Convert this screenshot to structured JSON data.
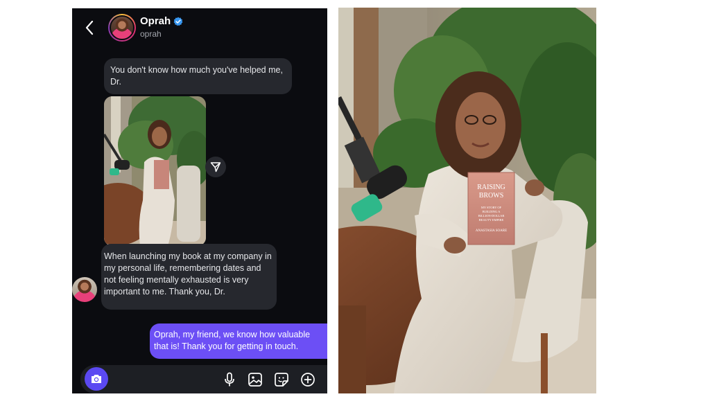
{
  "chat": {
    "contact": {
      "name": "Oprah",
      "handle": "oprah",
      "verified": true
    },
    "icons": {
      "back": "chevron-left-icon",
      "verified": "verified-badge-icon",
      "share": "send-icon",
      "camera": "camera-icon",
      "mic": "microphone-icon",
      "gallery": "image-icon",
      "sticker": "sticker-icon",
      "more": "plus-circle-icon"
    },
    "messages": [
      {
        "direction": "incoming",
        "type": "text",
        "text": "You don't know how much you've helped me, Dr."
      },
      {
        "direction": "incoming",
        "type": "photo"
      },
      {
        "direction": "incoming",
        "type": "text",
        "text": "When launching my book at my company in my personal life, remembering dates and not feeling mentally exhausted is very important to me. Thank you, Dr."
      },
      {
        "direction": "outgoing",
        "type": "text",
        "text": "Oprah, my friend, we know how valuable that is! Thank you for getting in touch."
      }
    ],
    "colors": {
      "background": "#0b0c10",
      "incoming_bubble": "#26282e",
      "outgoing_bubble": "#6c4ff5",
      "accent": "#5b49f2",
      "verified": "#3897f0"
    }
  },
  "book": {
    "title_line1": "RAISING",
    "title_line2": "BROWS",
    "subtitle_line1": "MY STORY OF",
    "subtitle_line2": "BUILDING A",
    "subtitle_line3": "BILLION-DOLLAR",
    "subtitle_line4": "BEAUTY EMPIRE",
    "author": "ANASTASIA SOARE"
  }
}
